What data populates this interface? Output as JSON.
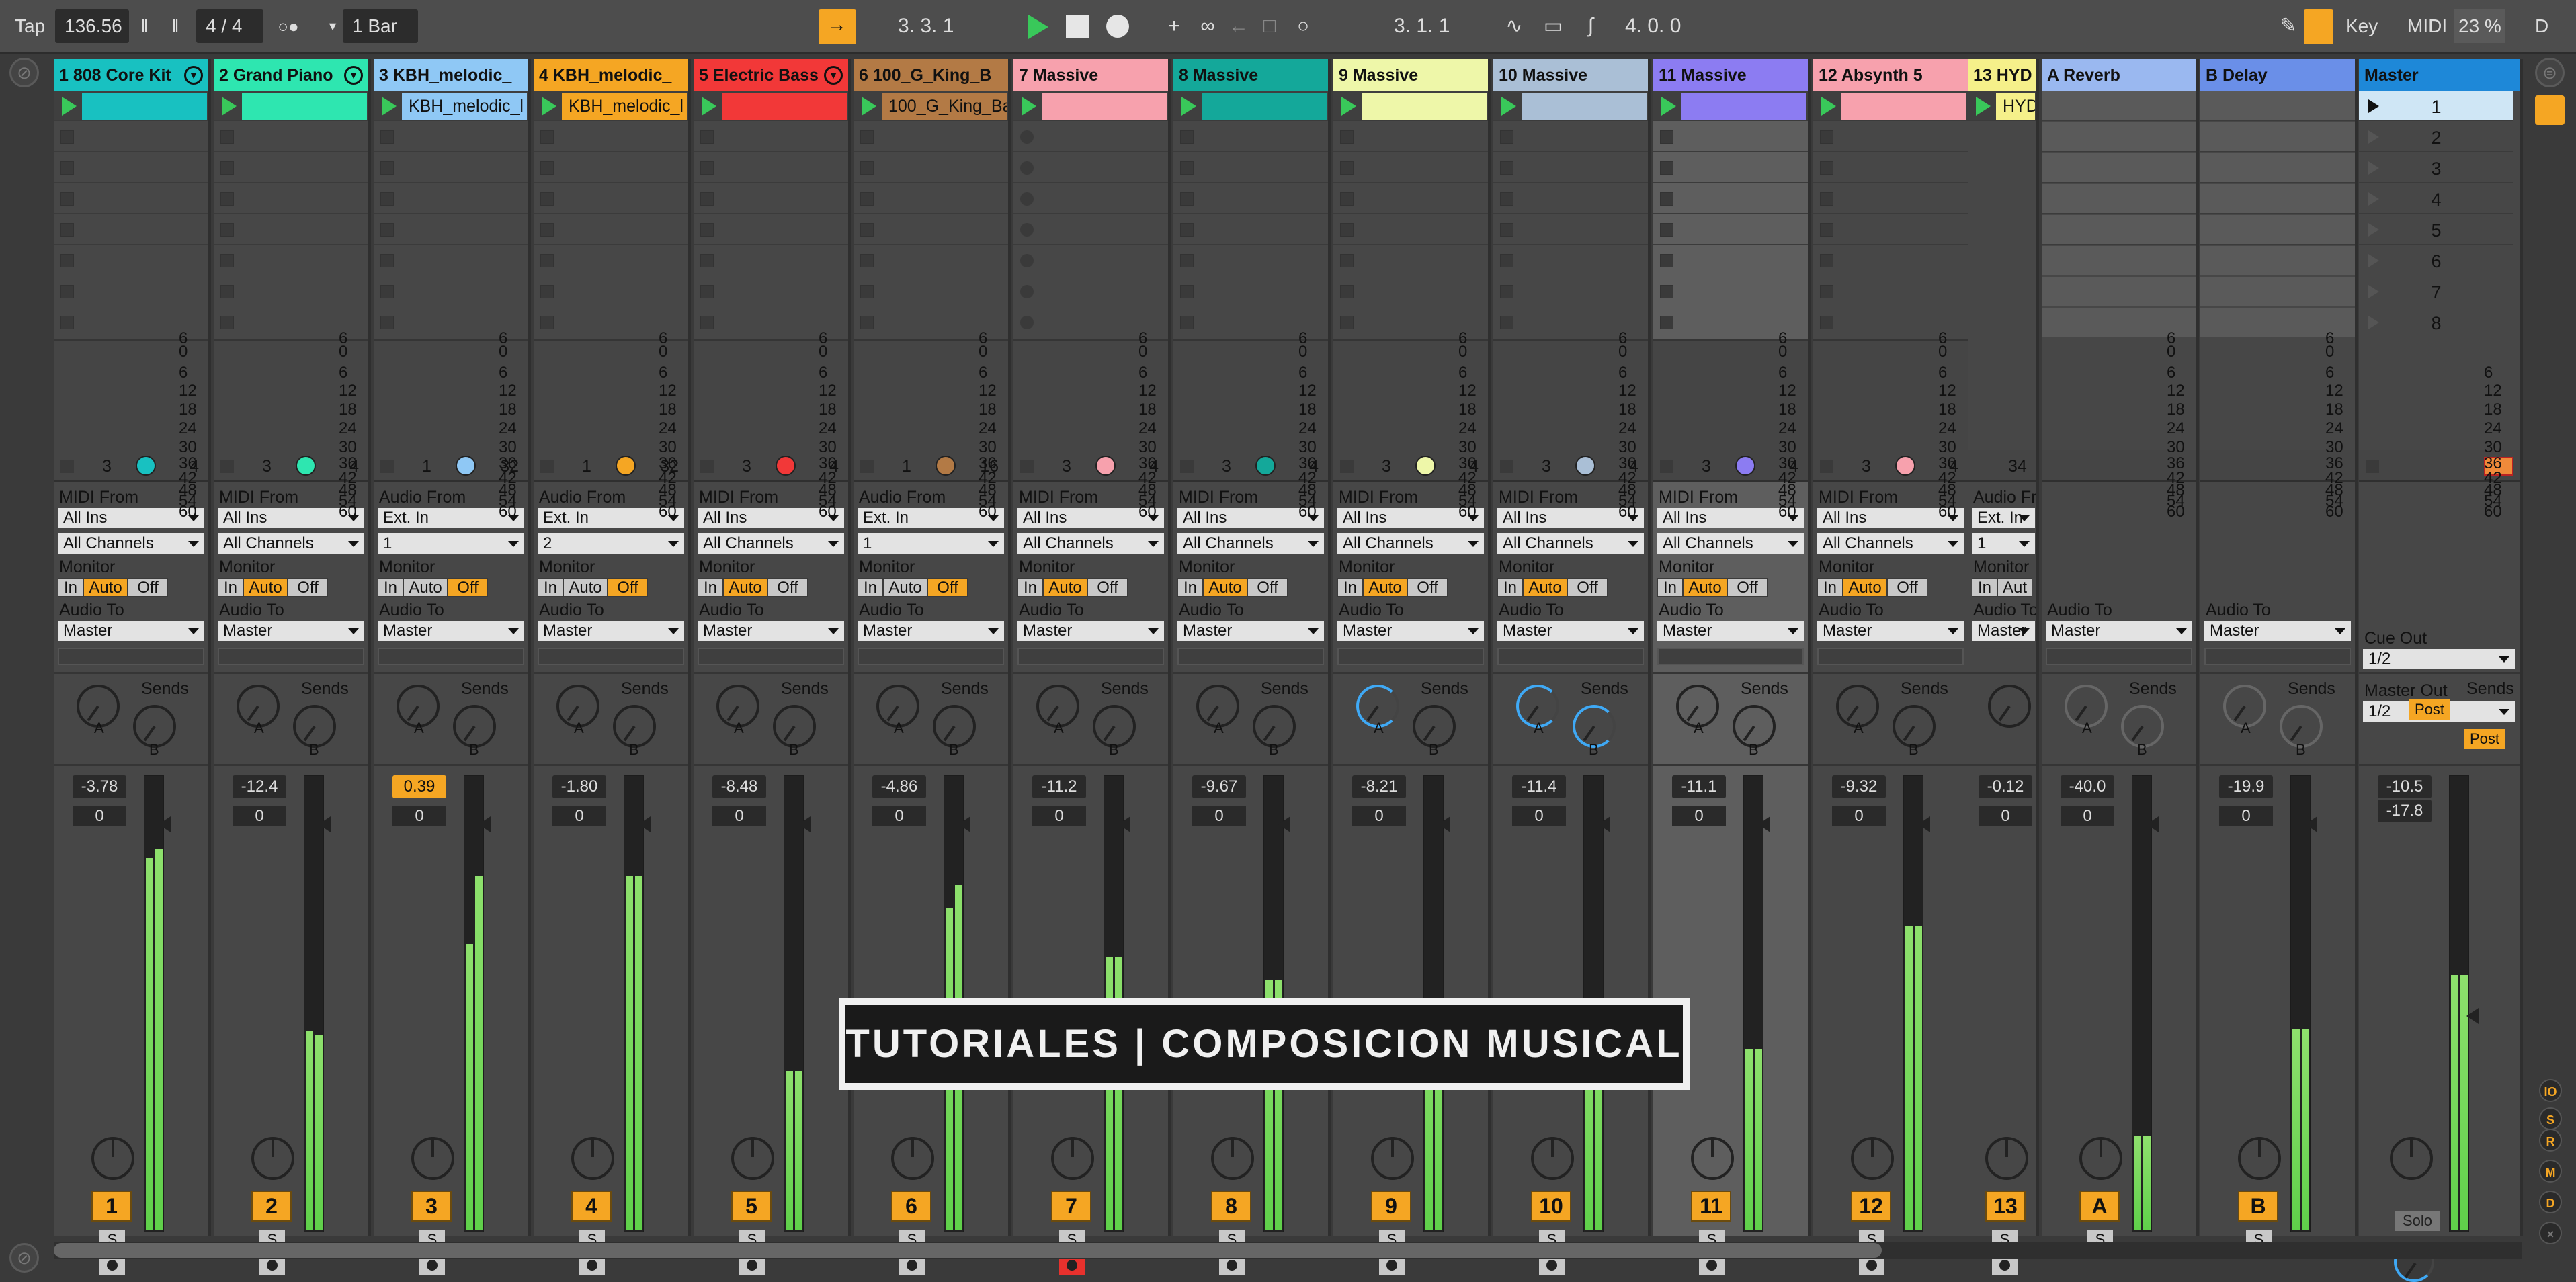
{
  "transport": {
    "tap": "Tap",
    "tempo": "136.56",
    "time_signature": "4 / 4",
    "quantize": "1 Bar",
    "song_position": "3.   3.   1",
    "loop_start": "3.   1.   1",
    "loop_length": "4.   0.   0",
    "key_label": "Key",
    "midi_label": "MIDI",
    "cpu": "23 %",
    "d_label": "D"
  },
  "tracks": [
    {
      "name": "1 808 Core Kit",
      "color": "#18c1c1",
      "clip": "",
      "clip_color": "#18c1c1",
      "slot": "stop",
      "clips_count": "3",
      "pie_color": "#18c1c1",
      "clips_total": "4",
      "io_type": "MIDI",
      "from": "All Ins",
      "channel": "All Channels",
      "monitor": "Auto",
      "audio_to": "Master",
      "volume": "-3.78",
      "pan": "0",
      "number": "1",
      "meter_l": 0.82,
      "meter_r": 0.84,
      "fold": true
    },
    {
      "name": "2 Grand Piano",
      "color": "#2ee6b0",
      "clip": "",
      "clip_color": "#2ee6b0",
      "slot": "stop",
      "clips_count": "3",
      "pie_color": "#2ee6b0",
      "clips_total": "4",
      "io_type": "MIDI",
      "from": "All Ins",
      "channel": "All Channels",
      "monitor": "Auto",
      "audio_to": "Master",
      "volume": "-12.4",
      "pan": "0",
      "number": "2",
      "meter_l": 0.44,
      "meter_r": 0.43,
      "fold": true
    },
    {
      "name": "3 KBH_melodic_",
      "color": "#8fc8f5",
      "clip": "KBH_melodic_l",
      "clip_color": "#8fc8f5",
      "slot": "stop",
      "clips_count": "1",
      "pie_color": "#8fc8f5",
      "clips_total": "32",
      "io_type": "Audio",
      "from": "Ext. In",
      "channel": "1",
      "monitor": "Off",
      "audio_to": "Master",
      "volume": "0.39",
      "volume_hl": true,
      "pan": "0",
      "number": "3",
      "meter_l": 0.63,
      "meter_r": 0.78,
      "fold": false
    },
    {
      "name": "4 KBH_melodic_",
      "color": "#f5a623",
      "clip": "KBH_melodic_l",
      "clip_color": "#f5a623",
      "slot": "stop",
      "clips_count": "1",
      "pie_color": "#f5a623",
      "clips_total": "32",
      "io_type": "Audio",
      "from": "Ext. In",
      "channel": "2",
      "monitor": "Off",
      "audio_to": "Master",
      "volume": "-1.80",
      "pan": "0",
      "number": "4",
      "meter_l": 0.78,
      "meter_r": 0.78,
      "fold": false
    },
    {
      "name": "5 Electric Bass",
      "color": "#f23838",
      "clip": "",
      "clip_color": "#f23838",
      "slot": "stop",
      "clips_count": "3",
      "pie_color": "#f23838",
      "clips_total": "4",
      "io_type": "MIDI",
      "from": "All Ins",
      "channel": "All Channels",
      "monitor": "Auto",
      "audio_to": "Master",
      "volume": "-8.48",
      "pan": "0",
      "number": "5",
      "meter_l": 0.35,
      "meter_r": 0.35,
      "fold": true
    },
    {
      "name": "6 100_G_King_B",
      "color": "#b37a45",
      "clip": "100_G_King_Ba",
      "clip_color": "#b37a45",
      "slot": "stop",
      "clips_count": "1",
      "pie_color": "#b37a45",
      "clips_total": "16",
      "io_type": "Audio",
      "from": "Ext. In",
      "channel": "1",
      "monitor": "Off",
      "audio_to": "Master",
      "volume": "-4.86",
      "pan": "0",
      "number": "6",
      "meter_l": 0.71,
      "meter_r": 0.76,
      "fold": false
    },
    {
      "name": "7 Massive",
      "color": "#f7a1ad",
      "clip": "",
      "clip_color": "#f7a1ad",
      "slot": "dot",
      "clips_count": "3",
      "pie_color": "#f7a1ad",
      "clips_total": "4",
      "io_type": "MIDI",
      "from": "All Ins",
      "channel": "All Channels",
      "monitor": "Auto",
      "audio_to": "Master",
      "volume": "-11.2",
      "pan": "0",
      "number": "7",
      "meter_l": 0.6,
      "meter_r": 0.6,
      "fold": false,
      "arm_red": true
    },
    {
      "name": "8 Massive",
      "color": "#14a89a",
      "clip": "",
      "clip_color": "#14a89a",
      "slot": "stop",
      "clips_count": "3",
      "pie_color": "#14a89a",
      "clips_total": "4",
      "io_type": "MIDI",
      "from": "All Ins",
      "channel": "All Channels",
      "monitor": "Auto",
      "audio_to": "Master",
      "volume": "-9.67",
      "pan": "0",
      "number": "8",
      "meter_l": 0.55,
      "meter_r": 0.55,
      "fold": false
    },
    {
      "name": "9 Massive",
      "color": "#eef7a9",
      "clip": "",
      "clip_color": "#eef7a9",
      "slot": "stop",
      "clips_count": "3",
      "pie_color": "#eef7a9",
      "clips_total": "4",
      "io_type": "MIDI",
      "from": "All Ins",
      "channel": "All Channels",
      "monitor": "Auto",
      "audio_to": "Master",
      "volume": "-8.21",
      "pan": "0",
      "number": "9",
      "meter_l": 0.5,
      "meter_r": 0.5,
      "fold": false
    },
    {
      "name": "10 Massive",
      "color": "#aabfd6",
      "clip": "",
      "clip_color": "#aabfd6",
      "slot": "stop",
      "clips_count": "3",
      "pie_color": "#aabfd6",
      "clips_total": "4",
      "io_type": "MIDI",
      "from": "All Ins",
      "channel": "All Channels",
      "monitor": "Auto",
      "audio_to": "Master",
      "volume": "-11.4",
      "pan": "0",
      "number": "10",
      "meter_l": 0.45,
      "meter_r": 0.45,
      "fold": false
    },
    {
      "name": "11 Massive",
      "color": "#8c7cf2",
      "clip": "",
      "clip_color": "#8c7cf2",
      "slot": "stop",
      "clips_count": "3",
      "pie_color": "#8c7cf2",
      "clips_total": "4",
      "io_type": "MIDI",
      "from": "All Ins",
      "channel": "All Channels",
      "monitor": "Auto",
      "audio_to": "Master",
      "volume": "-11.1",
      "pan": "0",
      "number": "11",
      "meter_l": 0.4,
      "meter_r": 0.4,
      "fold": false,
      "selected": true
    },
    {
      "name": "12 Absynth 5",
      "color": "#f7a1ad",
      "clip": "",
      "clip_color": "#f7a1ad",
      "slot": "stop",
      "clips_count": "3",
      "pie_color": "#f7a1ad",
      "clips_total": "4",
      "io_type": "MIDI",
      "from": "All Ins",
      "channel": "All Channels",
      "monitor": "Auto",
      "audio_to": "Master",
      "volume": "-9.32",
      "pan": "0",
      "number": "12",
      "meter_l": 0.67,
      "meter_r": 0.67,
      "fold": false
    }
  ],
  "track13": {
    "name": "13 HYD",
    "clip": "HYD",
    "color": "#f5f08a",
    "clips_total": "34",
    "from_label": "Audio Fr",
    "from": "Ext. In",
    "channel": "1",
    "monitor_label": "Monitor",
    "monitor_in": "In",
    "monitor_auto": "Aut",
    "audio_to_label": "Audio To",
    "audio_to": "Master",
    "volume": "-0.12",
    "pan": "0",
    "number": "13"
  },
  "returns": [
    {
      "name": "A Reverb",
      "color": "#9ab8f0",
      "audio_to": "Master",
      "volume": "-40.0",
      "pan": "0",
      "letter": "A"
    },
    {
      "name": "B Delay",
      "color": "#6a8fe8",
      "audio_to": "Master",
      "volume": "-19.9",
      "pan": "0",
      "letter": "B"
    }
  ],
  "master": {
    "name": "Master",
    "color": "#1e88d8",
    "scenes": [
      "1",
      "2",
      "3",
      "4",
      "5",
      "6",
      "7",
      "8"
    ],
    "cue_out_label": "Cue Out",
    "cue_out": "1/2",
    "master_out_label": "Master Out",
    "master_out": "1/2",
    "volume": "-10.5",
    "pan_value": "-17.8",
    "post_a": "Post",
    "post_b": "Post",
    "solo": "Solo",
    "sends_label": "Sends"
  },
  "labels": {
    "midi_from": "MIDI From",
    "audio_from": "Audio From",
    "monitor": "Monitor",
    "in": "In",
    "auto": "Auto",
    "off": "Off",
    "audio_to": "Audio To",
    "sends": "Sends",
    "send_a": "A",
    "send_b": "B",
    "solo": "S"
  },
  "meter_scale": [
    "6",
    "0",
    "6",
    "12",
    "18",
    "24",
    "30",
    "36",
    "42",
    "48",
    "54",
    "60"
  ],
  "banner": "TUTORIALES  |  COMPOSICION MUSICAL",
  "right_strip": [
    "IO",
    "S",
    "R",
    "M",
    "D"
  ]
}
